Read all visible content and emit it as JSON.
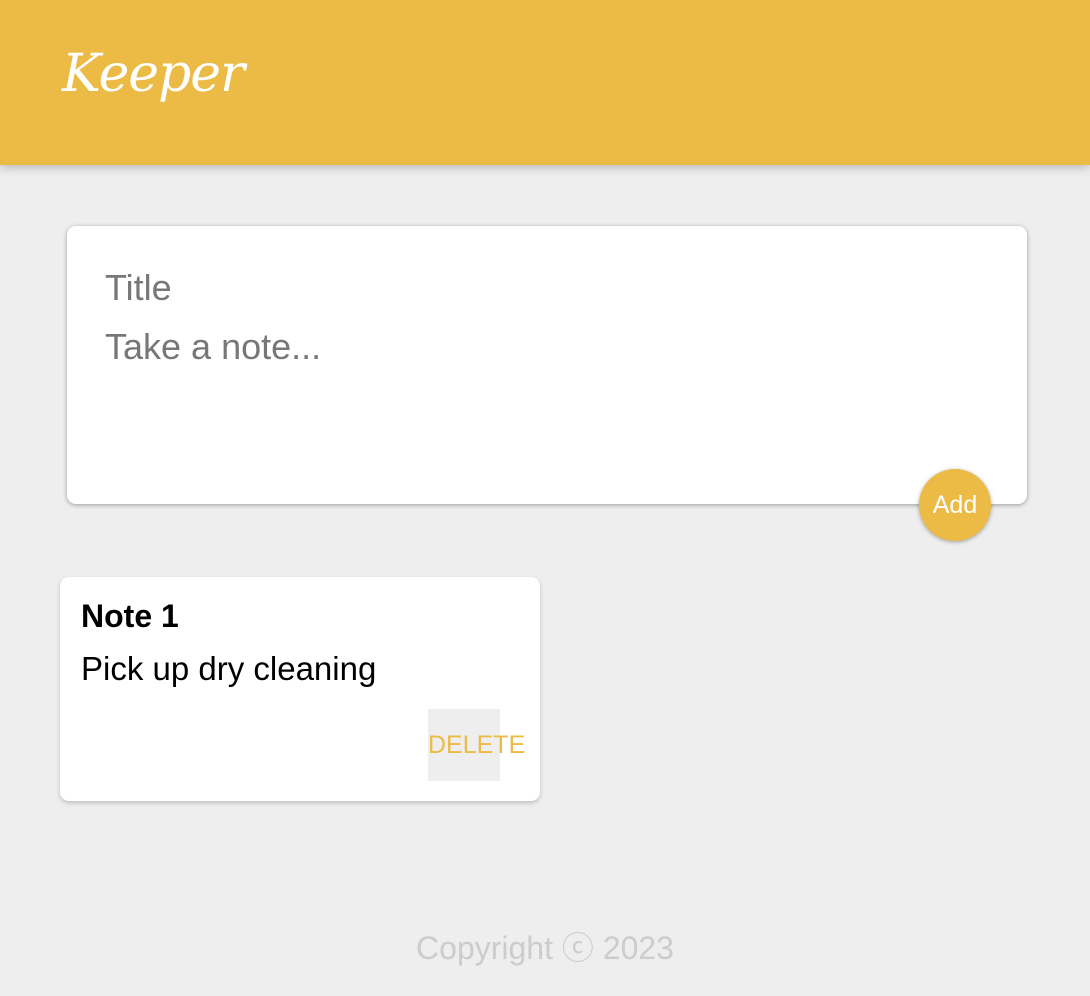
{
  "header": {
    "title": "Keeper"
  },
  "create_note": {
    "title_placeholder": "Title",
    "title_value": "",
    "content_placeholder": "Take a note...",
    "content_value": "",
    "add_label": "Add"
  },
  "notes": [
    {
      "title": "Note 1",
      "content": "Pick up dry cleaning",
      "delete_label": "DELETE"
    }
  ],
  "footer": {
    "copyright": "Copyright ⓒ 2023"
  },
  "colors": {
    "accent": "#ecbb45",
    "background": "#eeeeee",
    "card": "#ffffff",
    "placeholder": "#777777",
    "footer_text": "#cccccc"
  }
}
